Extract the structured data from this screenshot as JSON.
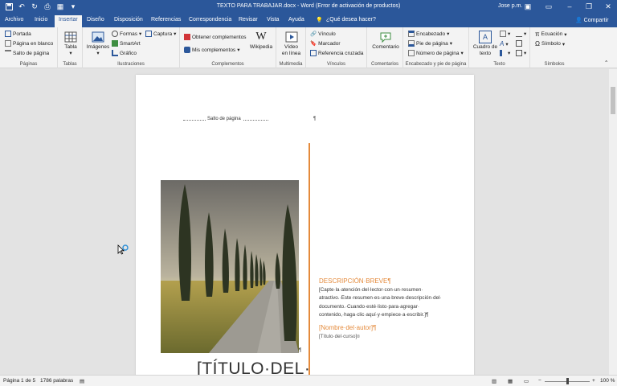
{
  "window": {
    "title": "TEXTO PARA TRABAJAR.docx - Word (Error de activación de productos)",
    "user": "Jose p.m."
  },
  "tabs": [
    "Archivo",
    "Inicio",
    "Insertar",
    "Diseño",
    "Disposición",
    "Referencias",
    "Correspondencia",
    "Revisar",
    "Vista",
    "Ayuda"
  ],
  "tell_me": "¿Qué desea hacer?",
  "share": "Compartir",
  "ribbon": {
    "paginas": {
      "label": "Páginas",
      "portada": "Portada",
      "pagina_blanco": "Página en blanco",
      "salto_pagina": "Salto de página"
    },
    "tablas": {
      "label": "Tablas",
      "tabla": "Tabla"
    },
    "ilustraciones": {
      "label": "Ilustraciones",
      "imagenes": "Imágenes",
      "formas": "Formas",
      "smartart": "SmartArt",
      "grafico": "Gráfico",
      "captura": "Captura"
    },
    "complementos": {
      "label": "Complementos",
      "obtener": "Obtener complementos",
      "mis": "Mis complementos",
      "wikipedia": "Wikipedia"
    },
    "multimedia": {
      "label": "Multimedia",
      "video_1": "Vídeo",
      "video_2": "en línea"
    },
    "vinculos": {
      "label": "Vínculos",
      "vinculo": "Vínculo",
      "marcador": "Marcador",
      "referencia": "Referencia cruzada"
    },
    "comentarios": {
      "label": "Comentarios",
      "comentario": "Comentario"
    },
    "encabezado": {
      "label": "Encabezado y pie de página",
      "encabezado": "Encabezado",
      "pie": "Pie de página",
      "numero": "Número de página"
    },
    "texto": {
      "label": "Texto",
      "cuadro_1": "Cuadro de",
      "cuadro_2": "texto"
    },
    "simbolos": {
      "label": "Símbolos",
      "ecuacion": "Ecuación",
      "simbolo": "Símbolo"
    }
  },
  "document": {
    "page_break": "Salto de página",
    "pilcrow": "¶",
    "descripcion_title": "DESCRIPCIÓN·BREVE¶",
    "descripcion_lines": [
      "[Capte·la·atención·del·lector·con·un·resumen·",
      "atractivo.·Este·resumen·es·una·breve·descripción·del·",
      "documento.·Cuando·esté·listo·para·agregar·",
      "contenido,·haga·clic·aquí·y·empiece·a·escribir.]¶"
    ],
    "autor": "[Nombre·del·autor]¶",
    "curso": "[Título·del·curso]¤",
    "titulo": "[TÍTULO·DEL·"
  },
  "status": {
    "pagina": "Página 1 de 5",
    "palabras": "1786 palabras",
    "zoom": "100 %"
  },
  "colors": {
    "accent": "#2b579a",
    "orange": "#e48a3b"
  }
}
